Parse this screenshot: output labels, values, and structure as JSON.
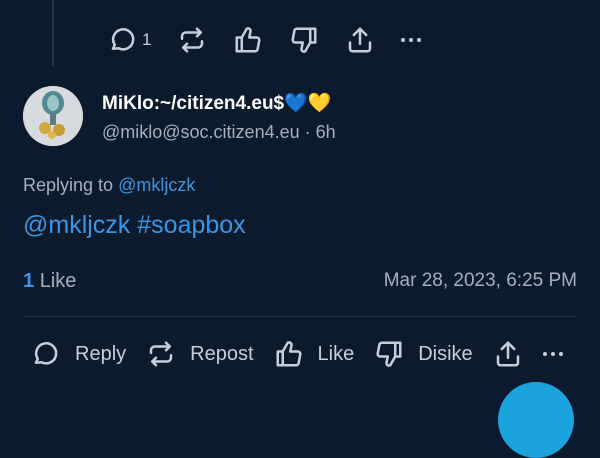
{
  "top_actions": {
    "reply_count": "1"
  },
  "post": {
    "display_name": "MiKlo:~/citizen4.eu$💙💛",
    "handle": "@miklo@soc.citizen4.eu",
    "separator": " · ",
    "age": "6h",
    "replying_prefix": "Replying to ",
    "replying_to": "@mkljczk",
    "text": "@mkljczk #soapbox",
    "likes_count": "1",
    "likes_label": "Like",
    "timestamp": "Mar 28, 2023, 6:25 PM"
  },
  "actions": {
    "reply": "Reply",
    "repost": "Repost",
    "like": "Like",
    "dislike": "Disike"
  },
  "colors": {
    "background": "#0b1a2d",
    "accent": "#3b97e6",
    "muted": "#a4b1c0",
    "fab": "#1ba3dd"
  }
}
